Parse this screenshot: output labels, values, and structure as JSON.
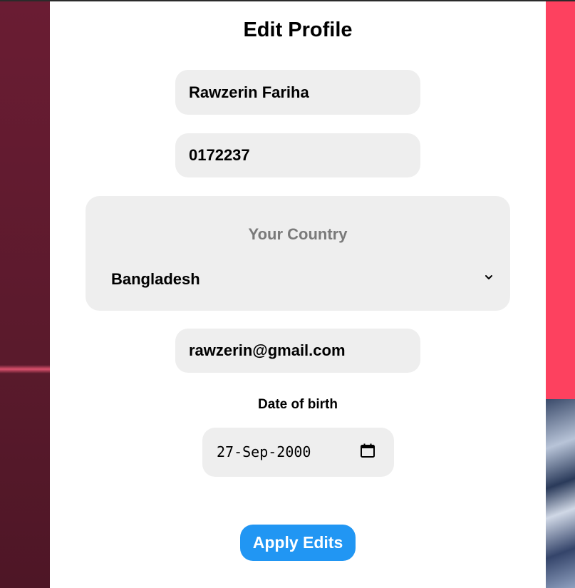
{
  "form": {
    "title": "Edit Profile",
    "name_value": "Rawzerin Fariha",
    "phone_value": "0172237",
    "country_label": "Your Country",
    "country_value": "Bangladesh",
    "email_value": "rawzerin@gmail.com",
    "dob_label": "Date of birth",
    "dob_value": "27-Sep-2000",
    "apply_label": "Apply Edits"
  },
  "icons": {
    "chevron": "chevron-down-icon",
    "calendar": "calendar-icon"
  },
  "colors": {
    "accent": "#2196f3",
    "field_bg": "#eeeeee",
    "left_bg": "#5e1a2e",
    "right_bg": "#fd415f"
  }
}
